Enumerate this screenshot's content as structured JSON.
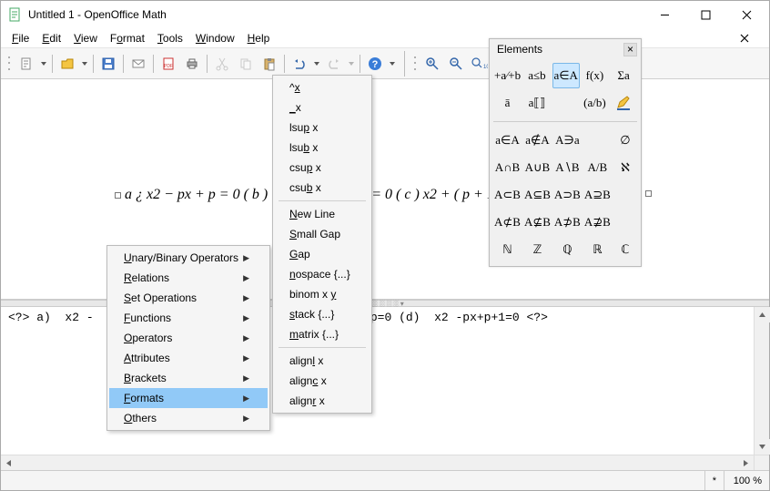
{
  "title": "Untitled 1 - OpenOffice Math",
  "menubar": [
    "File",
    "Edit",
    "View",
    "Format",
    "Tools",
    "Window",
    "Help"
  ],
  "formula_parts": {
    "a": "a ¿ x2 − px + p = 0",
    "b": "( b )",
    "c": "= 0 ( c ) x2 + ( p + 1 ) x + p",
    "trail_handle": true
  },
  "context_main": [
    "Unary/Binary Operators",
    "Relations",
    "Set Operations",
    "Functions",
    "Operators",
    "Attributes",
    "Brackets",
    "Formats",
    "Others"
  ],
  "context_main_hover_index": 7,
  "context_sub": [
    [
      "^x",
      "_x",
      "lsup x",
      "lsub x",
      "csup x",
      "csub x"
    ],
    [
      "New Line",
      "Small Gap",
      "Gap",
      "nospace {...}",
      "binom x y",
      "stack {...}",
      "matrix {...}"
    ],
    [
      "alignl x",
      "alignc x",
      "alignr x"
    ]
  ],
  "elements": {
    "title": "Elements",
    "top_row1": [
      {
        "label": "+a⁄+b",
        "name": "unary-binary"
      },
      {
        "label": "a≤b",
        "name": "relations"
      },
      {
        "label": "a∈A",
        "name": "set-ops",
        "selected": true
      },
      {
        "label": "f(x)",
        "name": "functions"
      },
      {
        "label": "Σa",
        "name": "operators"
      }
    ],
    "top_row2": [
      {
        "label": "ā",
        "name": "attributes"
      },
      {
        "label": "a⟦⟧",
        "name": "brackets"
      },
      {
        "label": "",
        "name": "blank1"
      },
      {
        "label": "(a/b)",
        "name": "formats"
      },
      {
        "label": "",
        "name": "others",
        "icon": "pen"
      }
    ],
    "bot": [
      [
        "a∈A",
        "a∉A",
        "A∋a",
        "",
        "∅"
      ],
      [
        "A∩B",
        "A∪B",
        "A∖B",
        "A/B",
        "ℵ"
      ],
      [
        "A⊂B",
        "A⊆B",
        "A⊃B",
        "A⊇B",
        ""
      ],
      [
        "A⊄B",
        "A⊈B",
        "A⊅B",
        "A⊉B",
        ""
      ],
      [
        "ℕ",
        "ℤ",
        "ℚ",
        "ℝ",
        "ℂ"
      ]
    ]
  },
  "code_line": "<?> a)  x2 -                             2+(p+1)x +p=0 (d)  x2 -px+p+1=0 <?>",
  "statusbar": {
    "modified": "*",
    "zoom": "100 %"
  },
  "splitter_handle": "▾░░░░▾"
}
